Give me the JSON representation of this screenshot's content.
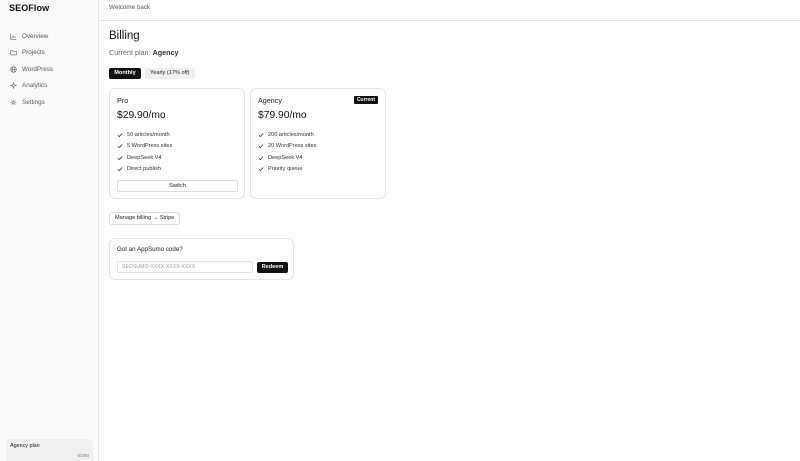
{
  "app": {
    "name": "SEOFlow"
  },
  "sidebar": {
    "items": [
      {
        "label": "Overview",
        "icon": "bar-chart-icon"
      },
      {
        "label": "Projects",
        "icon": "folder-icon"
      },
      {
        "label": "WordPress",
        "icon": "globe-icon"
      },
      {
        "label": "Analytics",
        "icon": "sparkle-icon"
      },
      {
        "label": "Settings",
        "icon": "gear-icon"
      }
    ],
    "plan": {
      "label": "Agency plan",
      "usage": "0/200"
    }
  },
  "header": {
    "welcome": "Welcome back"
  },
  "billing": {
    "title": "Billing",
    "current_plan_label": "Current plan:",
    "current_plan_value": "Agency",
    "toggle": {
      "monthly": "Monthly",
      "yearly": "Yearly (17% off)",
      "selected": "Monthly"
    },
    "plans": [
      {
        "name": "Pro",
        "price": "$29.90/mo",
        "features": [
          "50 articles/month",
          "5 WordPress sites",
          "DeepSeek V4",
          "Direct publish"
        ],
        "action": "Switch"
      },
      {
        "name": "Agency",
        "badge": "Current",
        "price": "$79.90/mo",
        "features": [
          "200 articles/month",
          "20 WordPress sites",
          "DeepSeek V4",
          "Priority queue"
        ]
      }
    ],
    "manage_button": "Manage billing → Stripe",
    "appsumo": {
      "title": "Got an AppSumo code?",
      "placeholder": "SEOSUMO-XXXX-XXXX-XXXX",
      "button": "Redeem"
    }
  },
  "colors": {
    "accent": "#111111",
    "border": "#e5e5e5",
    "sidebar_bg": "#fafafa"
  }
}
